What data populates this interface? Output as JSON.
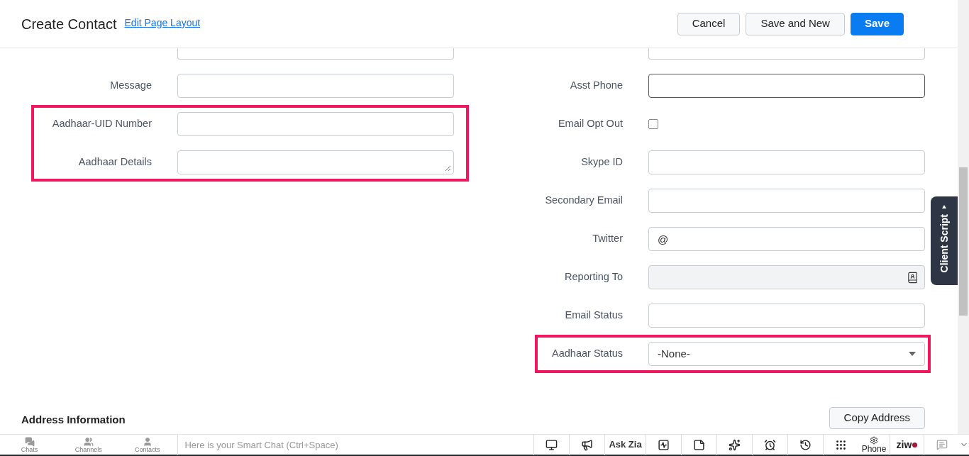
{
  "header": {
    "title": "Create Contact",
    "link": "Edit Page Layout",
    "buttons": [
      {
        "label": "Cancel",
        "kind": "secondary"
      },
      {
        "label": "Save and New",
        "kind": "secondary"
      },
      {
        "label": "Save",
        "kind": "primary"
      }
    ]
  },
  "left_fields": [
    {
      "label": "Message",
      "kind": "input",
      "highlighted": false
    },
    {
      "label": "Aadhaar-UID Number",
      "kind": "input",
      "highlighted": true
    },
    {
      "label": "Aadhaar Details",
      "kind": "textarea",
      "highlighted": true
    }
  ],
  "right_fields": [
    {
      "label": "Asst Phone",
      "kind": "input",
      "focused": true,
      "highlighted": false
    },
    {
      "label": "Email Opt Out",
      "kind": "checkbox",
      "checked": false,
      "highlighted": false
    },
    {
      "label": "Skype ID",
      "kind": "input",
      "focused": false,
      "highlighted": false
    },
    {
      "label": "Secondary Email",
      "kind": "input",
      "focused": false,
      "highlighted": false
    },
    {
      "label": "Twitter",
      "kind": "input",
      "value": "@",
      "focused": false,
      "highlighted": false
    },
    {
      "label": "Reporting To",
      "kind": "lookup",
      "disabled": true,
      "highlighted": false
    },
    {
      "label": "Email Status",
      "kind": "input",
      "focused": false,
      "highlighted": false
    },
    {
      "label": "Aadhaar Status",
      "kind": "select",
      "value": "-None-",
      "highlighted": true
    }
  ],
  "section": {
    "title": "Address Information",
    "button": "Copy Address"
  },
  "client_script": {
    "label": "Client Script"
  },
  "bottom_bar": {
    "tabs": [
      "Chats",
      "Channels",
      "Contacts"
    ],
    "chat_placeholder": "Here is your Smart Chat (Ctrl+Space)",
    "ask_zia": "Ask Zia",
    "phone": "Phone",
    "zia_logo": "ziw"
  }
}
